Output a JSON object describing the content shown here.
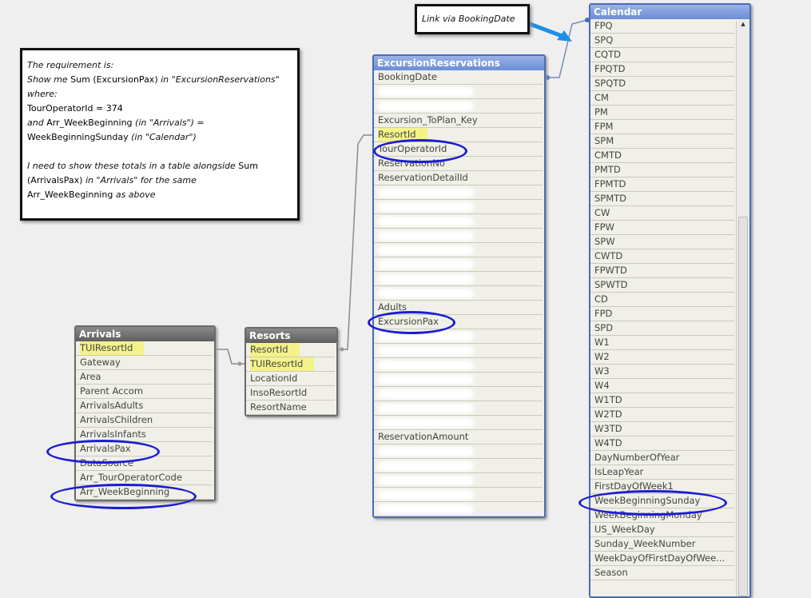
{
  "note": {
    "l1": "The requirement is:",
    "l2a": "Show me ",
    "l2b": "Sum (ExcursionPax)",
    "l2c": " in \"ExcursionReservations\"",
    "l3": "where:",
    "l4": "TourOperatorId = 374",
    "l5a": "and ",
    "l5b": "Arr_WeekBeginning",
    "l5c": " (in \"Arrivals\") =",
    "l6a": "WeekBeginningSunday",
    "l6b": " (in \"Calendar\")",
    "l7a": "I need to show these totals in a table alongside ",
    "l7b": "Sum",
    "l8a": "(ArrivalsPax)",
    "l8b": " in \"Arrivals\" for the same",
    "l9a": "Arr_WeekBeginning",
    "l9b": " as above"
  },
  "callout": {
    "text": "Link via BookingDate"
  },
  "tables": {
    "arrivals": {
      "title": "Arrivals",
      "fields": [
        "TUIResortId",
        "Gateway",
        "Area",
        "Parent Accom",
        "ArrivalsAdults",
        "ArrivalsChildren",
        "ArrivalsInfants",
        "ArrivalsPax",
        "DataSource",
        "Arr_TourOperatorCode",
        "Arr_WeekBeginning"
      ]
    },
    "resorts": {
      "title": "Resorts",
      "fields": [
        "ResortId",
        "TUIResortId",
        "LocationId",
        "InsoResortId",
        "ResortName"
      ]
    },
    "excursion": {
      "title": "ExcursionReservations",
      "fields": [
        "BookingDate",
        "",
        "",
        "Excursion_ToPlan_Key",
        "ResortId",
        "TourOperatorId",
        "ReservationNo",
        "ReservationDetailId",
        "",
        "",
        "",
        "",
        "",
        "",
        "",
        "",
        "Adults",
        "ExcursionPax",
        "",
        "",
        "",
        "",
        "",
        "",
        "",
        "ReservationAmount",
        "",
        "",
        "",
        "",
        ""
      ]
    },
    "calendar": {
      "title": "Calendar",
      "fields": [
        "FPQ",
        "SPQ",
        "CQTD",
        "FPQTD",
        "SPQTD",
        "CM",
        "PM",
        "FPM",
        "SPM",
        "CMTD",
        "PMTD",
        "FPMTD",
        "SPMTD",
        "CW",
        "FPW",
        "SPW",
        "CWTD",
        "FPWTD",
        "SPWTD",
        "CD",
        "FPD",
        "SPD",
        "W1",
        "W2",
        "W3",
        "W4",
        "W1TD",
        "W2TD",
        "W3TD",
        "W4TD",
        "DayNumberOfYear",
        "IsLeapYear",
        "FirstDayOfWeek1",
        "WeekBeginningSunday",
        "WeekBeginningMonday",
        "US_WeekDay",
        "Sunday_WeekNumber",
        "WeekDayOfFirstDayOfWee...",
        "Season"
      ]
    }
  },
  "highlights": {
    "arrivals": [
      "TUIResortId"
    ],
    "resorts": [
      "ResortId",
      "TUIResortId"
    ],
    "excursion": [
      "ResortId"
    ]
  },
  "circled": [
    "TourOperatorId",
    "ExcursionPax",
    "ArrivalsPax",
    "Arr_WeekBeginning",
    "WeekBeginningSunday"
  ]
}
